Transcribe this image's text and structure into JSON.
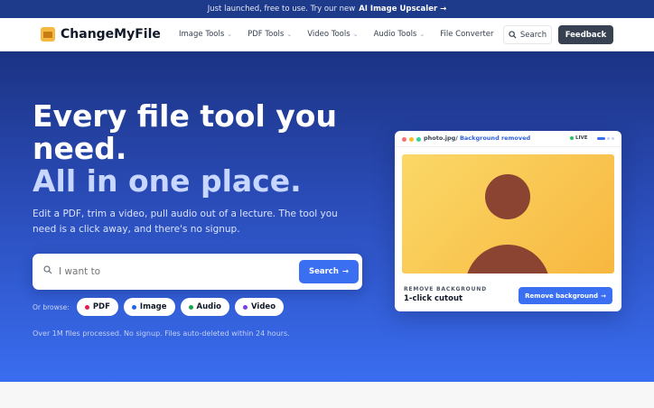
{
  "announce": {
    "text": "Just launched, free to use. Try our new",
    "link": "AI Image Upscaler",
    "arrow": "→"
  },
  "nav": {
    "logo": "ChangeMyFile",
    "menu": [
      {
        "label": "Image Tools",
        "has_dropdown": true
      },
      {
        "label": "PDF Tools",
        "has_dropdown": true
      },
      {
        "label": "Video Tools",
        "has_dropdown": true
      },
      {
        "label": "Audio Tools",
        "has_dropdown": true
      },
      {
        "label": "File Converter",
        "has_dropdown": false
      }
    ],
    "search_label": "Search",
    "feedback_label": "Feedback"
  },
  "hero": {
    "title_line1": "Every file tool you need.",
    "title_line2": "All in one place.",
    "subtitle": "Edit a PDF, trim a video, pull audio out of a lecture. The tool you need is a click away, and there's no signup.",
    "search_placeholder": "I want to",
    "search_button": "Search",
    "browse_label": "Or browse:",
    "chips": [
      {
        "label": "PDF",
        "color": "#e11d48"
      },
      {
        "label": "Image",
        "color": "#2563eb"
      },
      {
        "label": "Audio",
        "color": "#16a34a"
      },
      {
        "label": "Video",
        "color": "#7c3aed"
      }
    ],
    "note": "Over 1M files processed. No signup. Files auto-deleted within 24 hours."
  },
  "card": {
    "file_name": "photo.jpg/",
    "status": "Background removed",
    "live": "LIVE",
    "caption": "REMOVE BACKGROUND",
    "title": "1-click cutout",
    "button": "Remove background",
    "arrow": "→"
  },
  "colors": {
    "accent": "#3b6ff2",
    "nav_dark": "#374151",
    "announce_bg": "#1e3a8a"
  }
}
